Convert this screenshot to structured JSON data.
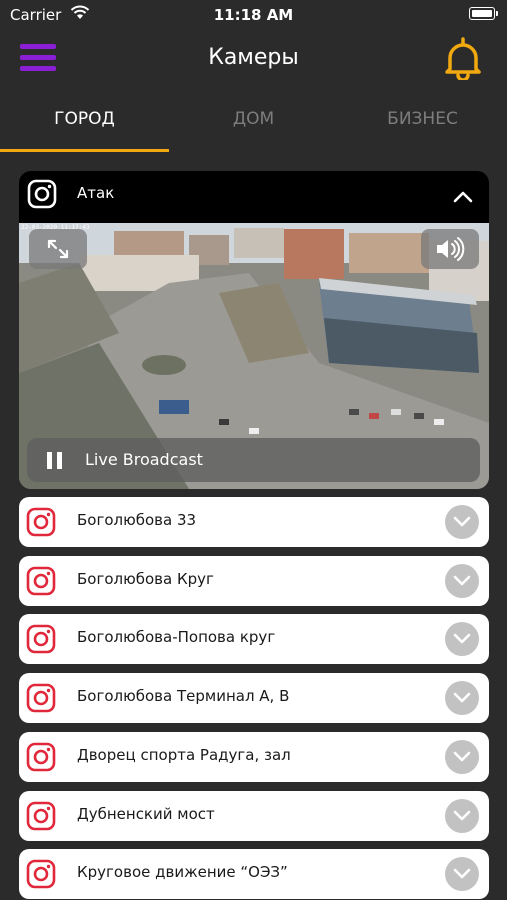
{
  "status_bar": {
    "carrier": "Carrier",
    "time": "11:18 AM"
  },
  "header": {
    "title": "Камеры",
    "menu_icon": "hamburger-menu-icon",
    "bell_icon": "bell-icon"
  },
  "colors": {
    "background": "#2b2b2b",
    "menu_accent": "#8b1fd6",
    "bell_accent": "#f1a90f",
    "tab_underline": "#f1a90f",
    "instagram_red": "#e0283a",
    "chevron_bg": "#c2c2c2"
  },
  "tabs": [
    {
      "label": "ГОРОД",
      "active": true
    },
    {
      "label": "ДОМ",
      "active": false
    },
    {
      "label": "БИЗНЕС",
      "active": false
    }
  ],
  "expanded_camera": {
    "title": "Атак",
    "icon": "instagram-icon",
    "video_timestamp": "22-03-2020 11:17:43",
    "live_label": "Live Broadcast",
    "controls": [
      "fullscreen-icon",
      "volume-icon",
      "pause-icon",
      "chevron-up-icon"
    ]
  },
  "cameras": [
    {
      "label": "Боголюбова 33"
    },
    {
      "label": "Боголюбова Круг"
    },
    {
      "label": "Боголюбова-Попова круг"
    },
    {
      "label": "Боголюбова Терминал А, В"
    },
    {
      "label": "Дворец спорта Радуга, зал"
    },
    {
      "label": "Дубненский мост"
    },
    {
      "label": "Круговое движение “ОЭЗ”"
    }
  ]
}
